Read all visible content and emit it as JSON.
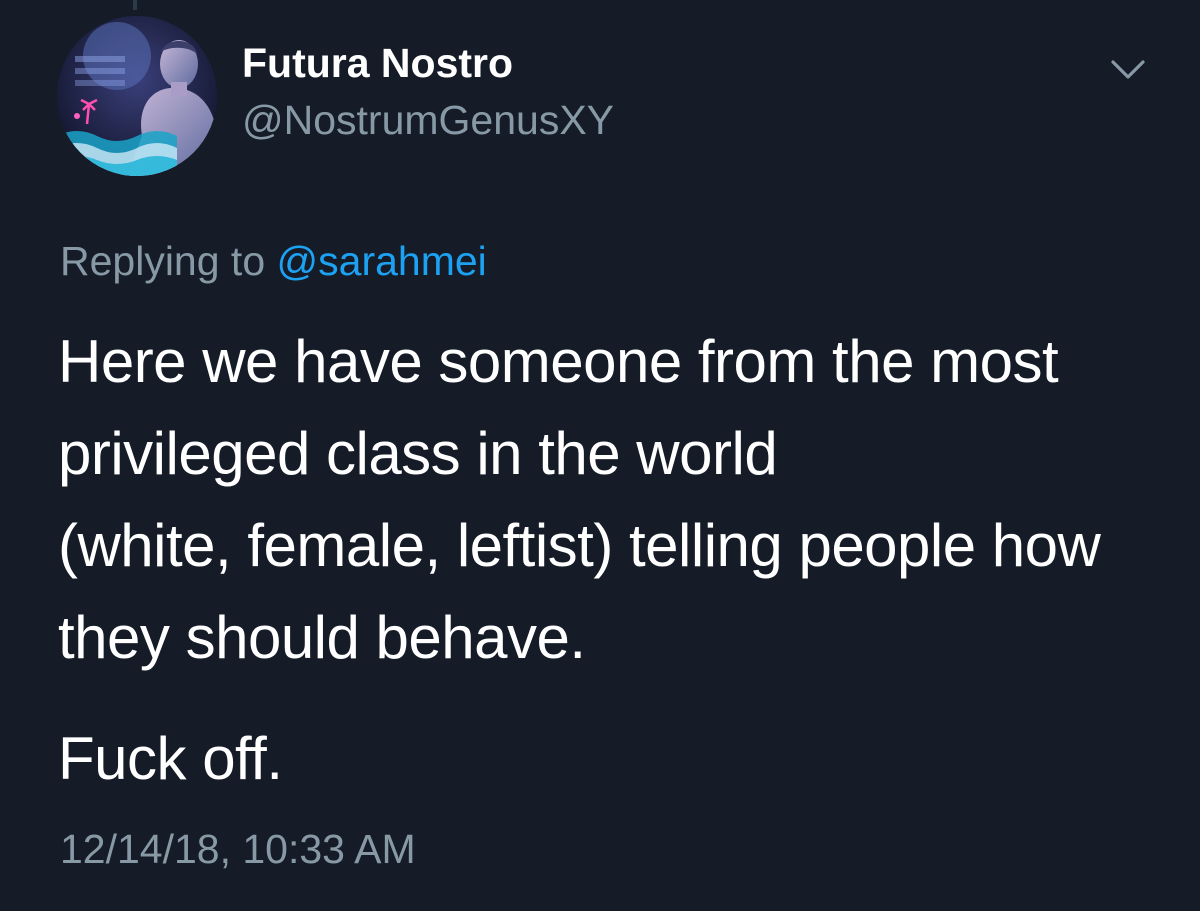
{
  "tweet": {
    "author": {
      "display_name": "Futura Nostro",
      "handle": "@NostrumGenusXY",
      "avatar_icon": "profile-avatar"
    },
    "menu_icon": "chevron-down-icon",
    "reply_context": {
      "prefix": "Replying to",
      "mention": "@sarahmei"
    },
    "body_lines": [
      "Here we have someone from the most",
      "privileged class in the world",
      "(white, female, leftist) telling people how",
      "they should behave."
    ],
    "body_final": "Fuck off.",
    "timestamp": "12/14/18, 10:33 AM"
  },
  "colors": {
    "background": "#151c27",
    "primary_text": "#ffffff",
    "secondary_text": "#8899a6",
    "link": "#1da1f2"
  }
}
